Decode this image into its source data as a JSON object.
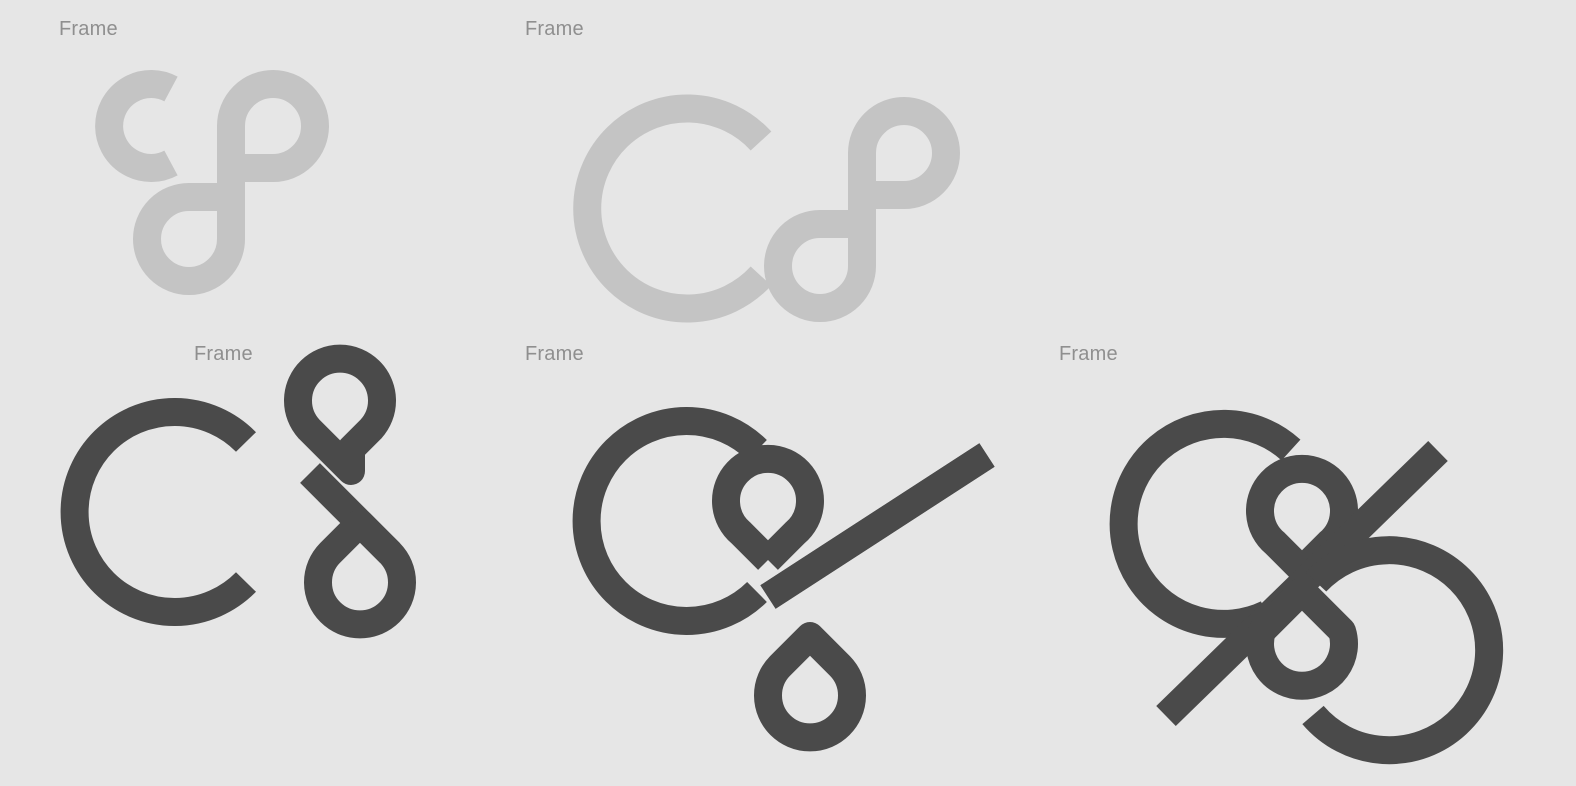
{
  "canvas": {
    "background": "#e6e6e6"
  },
  "colors": {
    "light_stroke": "#c4c4c4",
    "dark_stroke": "#4a4a4a",
    "label": "#8f8f8f"
  },
  "frames": [
    {
      "label": "Frame",
      "tone": "light"
    },
    {
      "label": "Frame",
      "tone": "light"
    },
    {
      "label": "Frame",
      "tone": "dark"
    },
    {
      "label": "Frame",
      "tone": "dark"
    },
    {
      "label": "Frame",
      "tone": "dark"
    }
  ]
}
